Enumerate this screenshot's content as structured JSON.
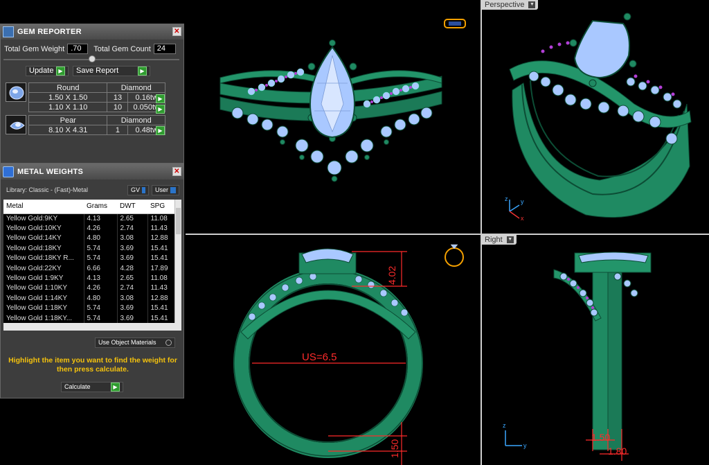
{
  "gem_reporter": {
    "title": "GEM REPORTER",
    "total_gem_weight_label": "Total Gem Weight",
    "total_gem_weight": ".70",
    "total_gem_count_label": "Total Gem Count",
    "total_gem_count": "24",
    "update_label": "Update",
    "save_report_label": "Save Report",
    "groups": [
      {
        "shape": "Round",
        "type": "Diamond",
        "rows": [
          {
            "size": "1.50 X 1.50",
            "count": "13",
            "weight": "0.16tw"
          },
          {
            "size": "1.10 X 1.10",
            "count": "10",
            "weight": "0.050tw"
          }
        ]
      },
      {
        "shape": "Pear",
        "type": "Diamond",
        "rows": [
          {
            "size": "8.10 X 4.31",
            "count": "1",
            "weight": "0.48tw"
          }
        ]
      }
    ]
  },
  "metal_weights": {
    "title": "METAL WEIGHTS",
    "library_label": "Library: Classic - (Fast)-Metal",
    "gv_label": "GV",
    "user_label": "User",
    "columns": [
      "Metal",
      "Grams",
      "DWT",
      "SPG"
    ],
    "rows": [
      [
        "Yellow Gold:9KY",
        "4.13",
        "2.65",
        "11.08"
      ],
      [
        "Yellow Gold:10KY",
        "4.26",
        "2.74",
        "11.43"
      ],
      [
        "Yellow Gold:14KY",
        "4.80",
        "3.08",
        "12.88"
      ],
      [
        "Yellow Gold:18KY",
        "5.74",
        "3.69",
        "15.41"
      ],
      [
        "Yellow Gold:18KY R...",
        "5.74",
        "3.69",
        "15.41"
      ],
      [
        "Yellow Gold:22KY",
        "6.66",
        "4.28",
        "17.89"
      ],
      [
        "Yellow Gold 1:9KY",
        "4.13",
        "2.65",
        "11.08"
      ],
      [
        "Yellow Gold 1:10KY",
        "4.26",
        "2.74",
        "11.43"
      ],
      [
        "Yellow Gold 1:14KY",
        "4.80",
        "3.08",
        "12.88"
      ],
      [
        "Yellow Gold 1:18KY",
        "5.74",
        "3.69",
        "15.41"
      ],
      [
        "Yellow Gold 1:18KY...",
        "5.74",
        "3.69",
        "15.41"
      ]
    ],
    "use_object_materials_label": "Use Object Materials",
    "highlight_message": "Highlight the item you want to find the weight for then press calculate.",
    "calculate_label": "Calculate"
  },
  "viewports": {
    "perspective_label": "Perspective",
    "right_label": "Right",
    "front_dims": {
      "height": "4.02",
      "ring_size": "US=6.5",
      "band": "1.50"
    },
    "right_dims": {
      "width1": "1.50",
      "width2": "1.80"
    }
  },
  "colors": {
    "metal": "#1f8a62",
    "gem": "#a9c8ff",
    "accent_stone": "#b23fd6",
    "dimension": "#ff2b2b",
    "highlight_text": "#f4c20d"
  }
}
